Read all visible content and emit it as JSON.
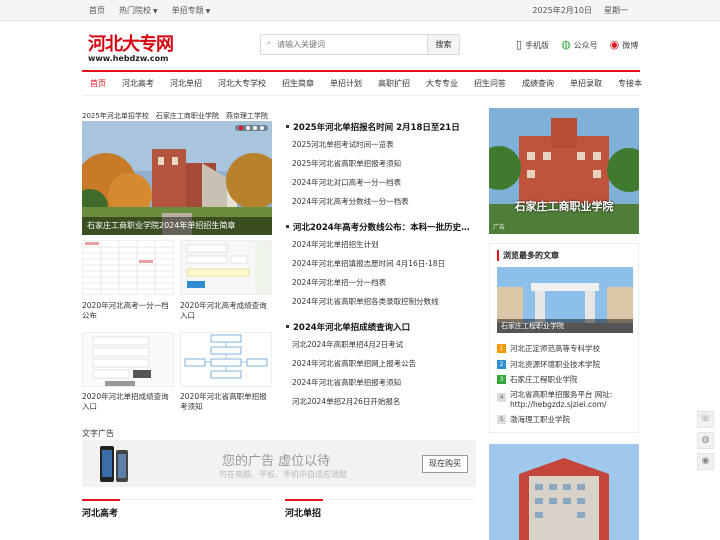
{
  "topbar": {
    "links": [
      "首页",
      "热门院校",
      "单招专题"
    ],
    "date": "2025年2月10日",
    "weekday": "星期一"
  },
  "header": {
    "logo_text": "河北大专网",
    "logo_url": "www.hebdzw.com",
    "search_placeholder": "请输入关键词",
    "search_button": "搜索",
    "links": [
      "手机版",
      "公众号",
      "微博"
    ]
  },
  "nav": [
    "首页",
    "河北高考",
    "河北单招",
    "河北大专学校",
    "招生简章",
    "单招计划",
    "高职扩招",
    "大专专业",
    "招生问答",
    "成绩查询",
    "单招录取",
    "专接本"
  ],
  "left": {
    "subtabs": [
      "2025年河北单招学校",
      "石家庄工商职业学院",
      "燕京理工学院"
    ],
    "banner_caption": "石家庄工商职业学院2024年单招招生简章",
    "thumbs": [
      "2020年河北高考一分一档公布",
      "2020年河北高考成绩查询入口",
      "2020年河北单招成绩查询入口",
      "2020年河北省高职单招报考须知"
    ]
  },
  "middle": {
    "groups": [
      {
        "headline": "2025年河北单招报名时间 2月18日至21日",
        "items": [
          "2025河北单招考试时间一览表",
          "2025年河北省高职单招报考须知",
          "2024年河北对口高考一分一档表",
          "2024年河北高考分数线一分一档表"
        ]
      },
      {
        "headline": "河北2024年高考分数线公布：本科一批历史…",
        "items": [
          "2024年河北单招招生计划",
          "2024年河北单招填报志愿时间 4月16日-18日",
          "2024年河北单招一分一档表",
          "2024年河北省高职单招各类录取控制分数线"
        ]
      },
      {
        "headline": "2024年河北单招成绩查询入口",
        "items": [
          "河北2024年高职单招4月2日考试",
          "2024年河北省高职单招网上报考公告",
          "2024年河北省高职单招报考须知",
          "河北2024单招2月26日开始报名"
        ]
      }
    ]
  },
  "right": {
    "banner_title": "石家庄工商职业学院",
    "banner_ad": "广告",
    "box_title": "浏览最多的文章",
    "box_img_caption": "石家庄工程职业学院",
    "list": [
      "河北正定师范高等专科学校",
      "河北资源环境职业技术学院",
      "石家庄工程职业学院",
      "河北省高职单招服务平台 网址: http://hebgzdz.sjziei.com/",
      "渤海理工职业学院"
    ]
  },
  "ad": {
    "label": "文字广告",
    "main": "您的广告 虚位以待",
    "sub": "可在电脑、平板、手机中自适应调整",
    "button": "现在购买"
  },
  "sections": [
    "河北高考",
    "河北单招"
  ]
}
